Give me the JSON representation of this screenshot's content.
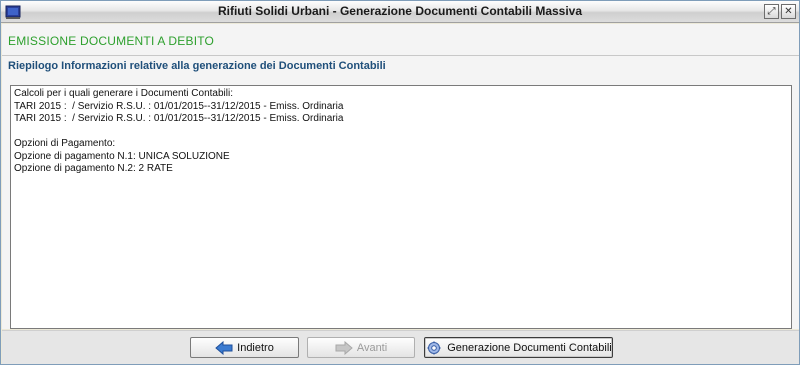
{
  "window": {
    "title": "Rifiuti Solidi Urbani - Generazione Documenti Contabili Massiva",
    "restore_glyph": "⤢",
    "close_glyph": "✕"
  },
  "header": {
    "section_title": "EMISSIONE DOCUMENTI A DEBITO",
    "subtitle": "Riepilogo Informazioni relative alla generazione dei Documenti Contabili"
  },
  "summary_lines": [
    "Calcoli per i quali generare i Documenti Contabili:",
    "TARI 2015 :  / Servizio R.S.U. : 01/01/2015--31/12/2015 - Emiss. Ordinaria",
    "TARI 2015 :  / Servizio R.S.U. : 01/01/2015--31/12/2015 - Emiss. Ordinaria",
    "",
    "Opzioni di Pagamento:",
    "Opzione di pagamento N.1: UNICA SOLUZIONE",
    "Opzione di pagamento N.2: 2 RATE"
  ],
  "footer": {
    "back_label": "Indietro",
    "next_label": "Avanti",
    "generate_label": "Generazione Documenti Contabili"
  },
  "icons": {
    "app": "app-icon",
    "back": "arrow-left-icon",
    "next": "arrow-right-icon",
    "generate": "gear-icon"
  },
  "colors": {
    "section_title": "#2ea02e",
    "subtitle": "#1f4f7a",
    "arrow_active": "#3b7bd1",
    "arrow_disabled": "#b5b5b5"
  }
}
